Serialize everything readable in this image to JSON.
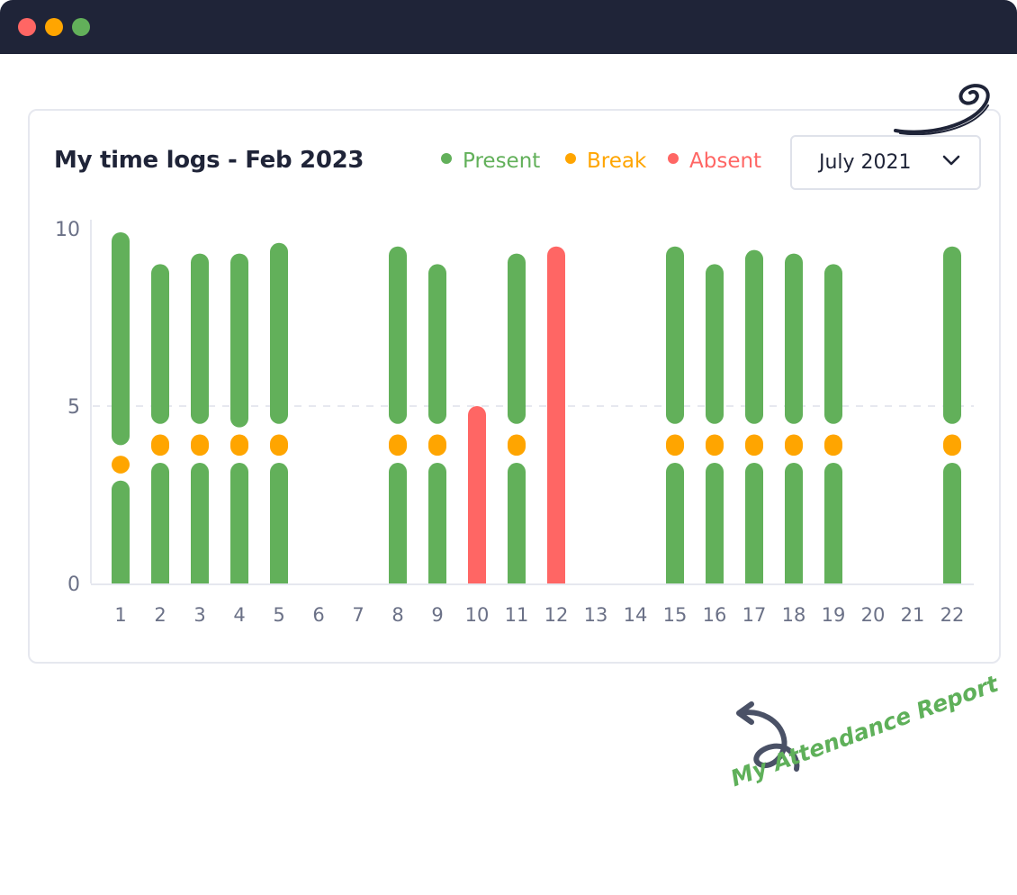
{
  "window": {
    "controls": [
      {
        "name": "close",
        "color": "#ff6664"
      },
      {
        "name": "minimize",
        "color": "#ffa500"
      },
      {
        "name": "maximize",
        "color": "#62b05a"
      }
    ]
  },
  "card": {
    "title": "My time logs - Feb 2023",
    "legend": [
      {
        "label": "Present",
        "color": "#62b05a"
      },
      {
        "label": "Break",
        "color": "#ffa500"
      },
      {
        "label": "Absent",
        "color": "#ff6664"
      }
    ],
    "month_select": {
      "value": "July 2021",
      "icon": "chevron-down-icon"
    }
  },
  "annotation": {
    "text": "My Attendance Report",
    "icon": "curly-arrow-icon"
  },
  "colors": {
    "present": "#62b05a",
    "break": "#ffa500",
    "absent": "#ff6664",
    "axis_text": "#6b7187",
    "title": "#1f2438"
  },
  "chart_data": {
    "type": "bar",
    "title": "My time logs - Feb 2023",
    "xlabel": "",
    "ylabel": "",
    "ylim": [
      0,
      10
    ],
    "yticks": [
      0,
      5,
      10
    ],
    "grid": "dashed line at 5",
    "legend_position": "top-right",
    "categories": [
      "1",
      "2",
      "3",
      "4",
      "5",
      "6",
      "7",
      "8",
      "9",
      "10",
      "11",
      "12",
      "13",
      "14",
      "15",
      "16",
      "17",
      "18",
      "19",
      "20",
      "21",
      "22"
    ],
    "days": [
      {
        "day": "1",
        "segments": [
          {
            "type": "present",
            "from": 0,
            "to": 2.9
          },
          {
            "type": "break",
            "from": 3.1,
            "to": 3.6
          },
          {
            "type": "present",
            "from": 3.9,
            "to": 9.9
          }
        ]
      },
      {
        "day": "2",
        "segments": [
          {
            "type": "present",
            "from": 0,
            "to": 3.4
          },
          {
            "type": "break",
            "from": 3.6,
            "to": 4.2
          },
          {
            "type": "present",
            "from": 4.5,
            "to": 9.0
          }
        ]
      },
      {
        "day": "3",
        "segments": [
          {
            "type": "present",
            "from": 0,
            "to": 3.4
          },
          {
            "type": "break",
            "from": 3.6,
            "to": 4.2
          },
          {
            "type": "present",
            "from": 4.5,
            "to": 9.3
          }
        ]
      },
      {
        "day": "4",
        "segments": [
          {
            "type": "present",
            "from": 0,
            "to": 3.4
          },
          {
            "type": "break",
            "from": 3.6,
            "to": 4.2
          },
          {
            "type": "present",
            "from": 4.4,
            "to": 9.3
          }
        ]
      },
      {
        "day": "5",
        "segments": [
          {
            "type": "present",
            "from": 0,
            "to": 3.4
          },
          {
            "type": "break",
            "from": 3.6,
            "to": 4.2
          },
          {
            "type": "present",
            "from": 4.5,
            "to": 9.6
          }
        ]
      },
      {
        "day": "6",
        "segments": []
      },
      {
        "day": "7",
        "segments": []
      },
      {
        "day": "8",
        "segments": [
          {
            "type": "present",
            "from": 0,
            "to": 3.4
          },
          {
            "type": "break",
            "from": 3.6,
            "to": 4.2
          },
          {
            "type": "present",
            "from": 4.5,
            "to": 9.5
          }
        ]
      },
      {
        "day": "9",
        "segments": [
          {
            "type": "present",
            "from": 0,
            "to": 3.4
          },
          {
            "type": "break",
            "from": 3.6,
            "to": 4.2
          },
          {
            "type": "present",
            "from": 4.5,
            "to": 9.0
          }
        ]
      },
      {
        "day": "10",
        "segments": [
          {
            "type": "absent",
            "from": 0,
            "to": 5.0
          }
        ]
      },
      {
        "day": "11",
        "segments": [
          {
            "type": "present",
            "from": 0,
            "to": 3.4
          },
          {
            "type": "break",
            "from": 3.6,
            "to": 4.2
          },
          {
            "type": "present",
            "from": 4.5,
            "to": 9.3
          }
        ]
      },
      {
        "day": "12",
        "segments": [
          {
            "type": "absent",
            "from": 0,
            "to": 9.5
          }
        ]
      },
      {
        "day": "13",
        "segments": []
      },
      {
        "day": "14",
        "segments": []
      },
      {
        "day": "15",
        "segments": [
          {
            "type": "present",
            "from": 0,
            "to": 3.4
          },
          {
            "type": "break",
            "from": 3.6,
            "to": 4.2
          },
          {
            "type": "present",
            "from": 4.5,
            "to": 9.5
          }
        ]
      },
      {
        "day": "16",
        "segments": [
          {
            "type": "present",
            "from": 0,
            "to": 3.4
          },
          {
            "type": "break",
            "from": 3.6,
            "to": 4.2
          },
          {
            "type": "present",
            "from": 4.5,
            "to": 9.0
          }
        ]
      },
      {
        "day": "17",
        "segments": [
          {
            "type": "present",
            "from": 0,
            "to": 3.4
          },
          {
            "type": "break",
            "from": 3.6,
            "to": 4.2
          },
          {
            "type": "present",
            "from": 4.5,
            "to": 9.4
          }
        ]
      },
      {
        "day": "18",
        "segments": [
          {
            "type": "present",
            "from": 0,
            "to": 3.4
          },
          {
            "type": "break",
            "from": 3.6,
            "to": 4.2
          },
          {
            "type": "present",
            "from": 4.5,
            "to": 9.3
          }
        ]
      },
      {
        "day": "19",
        "segments": [
          {
            "type": "present",
            "from": 0,
            "to": 3.4
          },
          {
            "type": "break",
            "from": 3.6,
            "to": 4.2
          },
          {
            "type": "present",
            "from": 4.5,
            "to": 9.0
          }
        ]
      },
      {
        "day": "20",
        "segments": []
      },
      {
        "day": "21",
        "segments": []
      },
      {
        "day": "22",
        "segments": [
          {
            "type": "present",
            "from": 0,
            "to": 3.4
          },
          {
            "type": "break",
            "from": 3.6,
            "to": 4.2
          },
          {
            "type": "present",
            "from": 4.5,
            "to": 9.5
          }
        ]
      }
    ]
  }
}
